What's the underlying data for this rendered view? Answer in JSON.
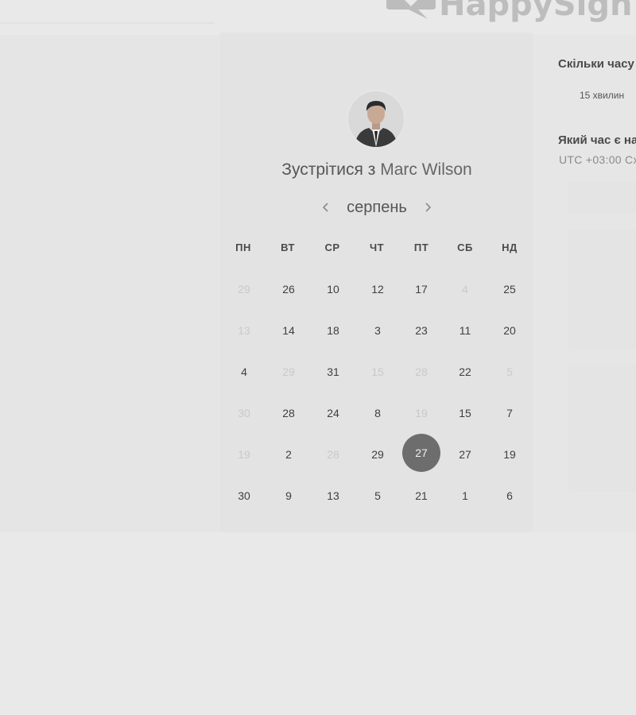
{
  "header": {
    "logo_text": "HappySign",
    "logo_icon": "speech-bubble-heart-icon"
  },
  "calendar": {
    "title_prefix": "Зустрітися з",
    "host_name": "Marc Wilson",
    "month": "серпень",
    "prev_icon": "chevron-left-icon",
    "next_icon": "chevron-right-icon",
    "weekdays": [
      "ПН",
      "ВТ",
      "СР",
      "ЧТ",
      "ПТ",
      "СБ",
      "НД"
    ],
    "weeks": [
      [
        {
          "d": "29",
          "m": true
        },
        {
          "d": "26"
        },
        {
          "d": "10"
        },
        {
          "d": "12"
        },
        {
          "d": "17"
        },
        {
          "d": "4",
          "m": true
        },
        {
          "d": "25"
        }
      ],
      [
        {
          "d": "13",
          "m": true
        },
        {
          "d": "14"
        },
        {
          "d": "18"
        },
        {
          "d": "3"
        },
        {
          "d": "23"
        },
        {
          "d": "11"
        },
        {
          "d": "20"
        }
      ],
      [
        {
          "d": "4"
        },
        {
          "d": "29",
          "m": true
        },
        {
          "d": "31"
        },
        {
          "d": "15",
          "m": true
        },
        {
          "d": "28",
          "m": true
        },
        {
          "d": "22"
        },
        {
          "d": "5",
          "m": true
        }
      ],
      [
        {
          "d": "30",
          "m": true
        },
        {
          "d": "28"
        },
        {
          "d": "24"
        },
        {
          "d": "8"
        },
        {
          "d": "19",
          "m": true
        },
        {
          "d": "15"
        },
        {
          "d": "7"
        }
      ],
      [
        {
          "d": "19",
          "m": true
        },
        {
          "d": "2"
        },
        {
          "d": "28",
          "m": true
        },
        {
          "d": "29"
        },
        {
          "d": "27",
          "s": true
        },
        {
          "d": "27"
        },
        {
          "d": "19"
        }
      ],
      [
        {
          "d": "30"
        },
        {
          "d": "9"
        },
        {
          "d": "13"
        },
        {
          "d": "5"
        },
        {
          "d": "21"
        },
        {
          "d": "1"
        },
        {
          "d": "6"
        }
      ]
    ],
    "colors": {
      "selected": "#6d6d6d",
      "text": "#3f3f3f",
      "muted": "#c9c9c9"
    }
  },
  "details": {
    "duration_question": "Скільки часу",
    "duration_value": "15 хвилин",
    "time_question": "Який час є на",
    "timezone": "UTC +03:00 Сх"
  }
}
